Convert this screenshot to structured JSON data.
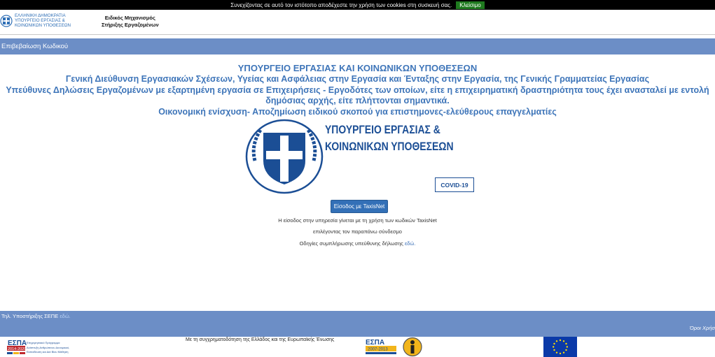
{
  "cookie": {
    "text": "Συνεχίζοντας σε αυτό τον ιστότοπο αποδέχεστε την χρήση των cookies στη συσκευή σας.",
    "button": "Κλείσιμο"
  },
  "header": {
    "logo_lines": [
      "ΕΛΛΗΝΙΚΗ ΔΗΜΟΚΡΑΤΙΑ",
      "ΥΠΟΥΡΓΕΙΟ ΕΡΓΑΣΙΑΣ &",
      "ΚΟΙΝΩΝΙΚΩΝ ΥΠΟΘΕΣΕΩΝ"
    ],
    "program_line1": "Ειδικός Μηχανισμός",
    "program_line2": "Στήριξης Εργαζομένων"
  },
  "subheader": {
    "title": "Επιβεβαίωση Κωδικού"
  },
  "main": {
    "heading1": "ΥΠΟΥΡΓΕΙΟ ΕΡΓΑΣΙΑΣ ΚΑΙ ΚΟΙΝΩΝΙΚΩΝ ΥΠΟΘΕΣΕΩΝ",
    "heading2": "Γενική Διεύθυνση Εργασιακών Σχέσεων, Υγείας και Ασφάλειας στην Εργασία και Ένταξης στην Εργασία, της Γενικής Γραμματείας Εργασίας",
    "heading3": "Υπεύθυνες Δηλώσεις Εργαζομένων με εξαρτημένη εργασία σε Επιχειρήσεις - Εργοδότες των οποίων, είτε η επιχειρηματική δραστηριότητα τους έχει ανασταλεί με εντολή δημόσιας αρχής, είτε πλήττονται σημαντικά.",
    "heading4": "Οικονομική ενίσχυση- Αποζημίωση ειδικού σκοπού για επιστημονες-ελεύθερους επαγγελματίες",
    "banner": {
      "line1": "ΥΠΟΥΡΓΕΙΟ ΕΡΓΑΣΙΑΣ &",
      "line2": "ΚΟΙΝΩΝΙΚΩΝ ΥΠΟΘΕΣΕΩΝ",
      "badge": "COVID-19"
    },
    "login_button": "Είσοδος με TaxisNet",
    "info1": "Η είσοδος στην υπηρεσία γίνεται με τη χρήση των κωδικών TaxisNet",
    "info2": "επιλέγοντας τον παραπάνω σύνδεσμο",
    "info3": "Οδηγίες συμπλήρωσης υπεύθυνης δήλωσης",
    "info3_link": "εδώ."
  },
  "footer": {
    "support": "Τηλ. Υποστήριξης ΣΕΠΕ",
    "support_link": "εδώ.",
    "terms": "Όροι Χρήσ",
    "cofunding": "Με τη συγχρηματοδότηση της Ελλάδος και της Ευρωπαϊκής Ένωσης",
    "espa1": {
      "title": "ΕΣΠΑ",
      "years": "2014-2020",
      "text_lines": [
        "Επιχειρησιακό Πρόγραμμα",
        "Ανάπτυξη Ανθρώπινου Δυναμικού,",
        "Εκπαίδευση και Διά Βίου Μάθηση"
      ]
    },
    "espa2": {
      "title": "ΕΣΠΑ",
      "years": "2007-2013"
    }
  },
  "colors": {
    "accent": "#6c8ec6",
    "heading": "#3e75b9",
    "button": "#3370b7",
    "cookie_button": "#1f7a1f"
  }
}
